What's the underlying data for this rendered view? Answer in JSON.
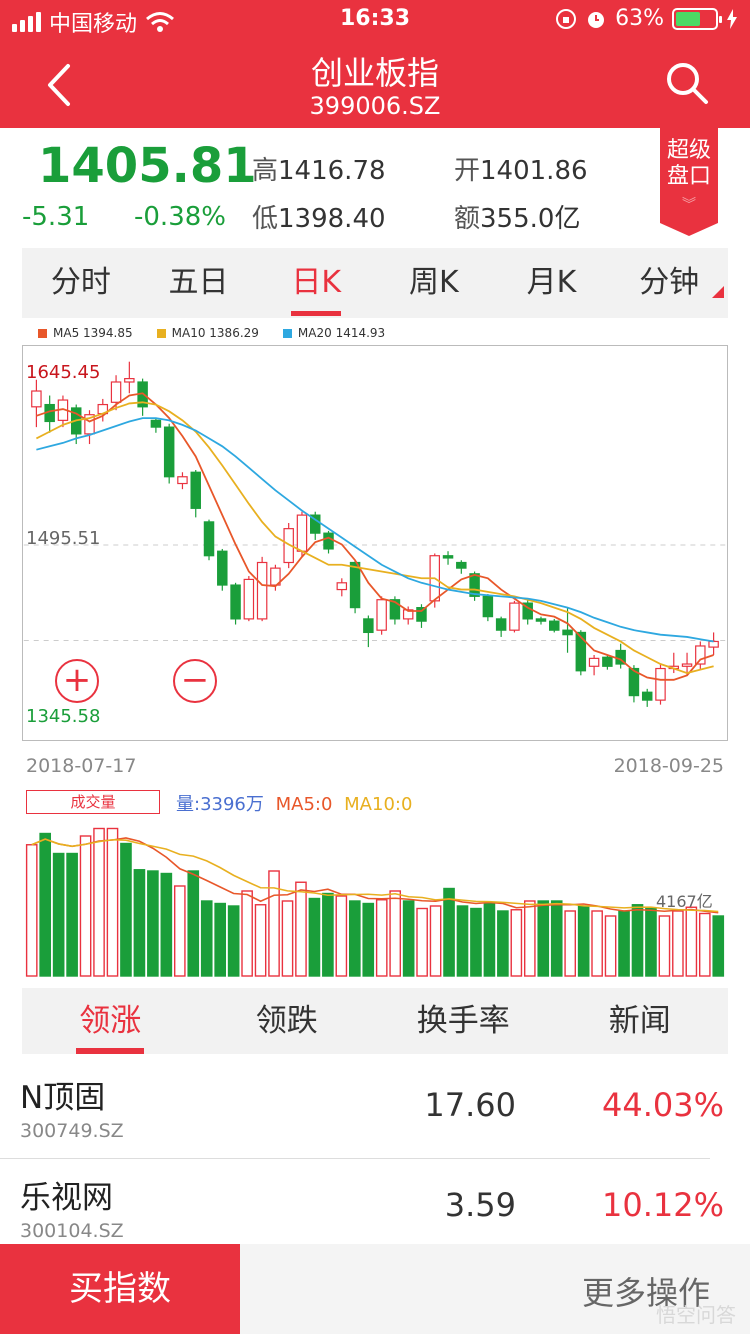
{
  "status": {
    "carrier": "中国移动",
    "time": "16:33",
    "battery": "63%",
    "battery_level": 0.63
  },
  "nav": {
    "title": "创业板指",
    "code": "399006.SZ"
  },
  "quote": {
    "price": "1405.81",
    "change": "-5.31",
    "change_pct": "-0.38%",
    "high_label": "高",
    "high": "1416.78",
    "open_label": "开",
    "open": "1401.86",
    "low_label": "低",
    "low": "1398.40",
    "amount_label": "额",
    "amount": "355.0亿"
  },
  "super_badge": {
    "line1": "超级",
    "line2": "盘口"
  },
  "tabs": [
    "分时",
    "五日",
    "日K",
    "周K",
    "月K",
    "分钟"
  ],
  "active_tab": 2,
  "chart_data": {
    "type": "candlestick",
    "legend": [
      "MA5 1394.85",
      "MA10 1386.29",
      "MA20 1414.93"
    ],
    "ma_colors": [
      "#e8572a",
      "#e8b020",
      "#2ea8e0"
    ],
    "y_labels": [
      "1645.45",
      "1495.51",
      "1345.58"
    ],
    "ylim": [
      1345.58,
      1645.45
    ],
    "start_date": "2018-07-17",
    "end_date": "2018-09-25",
    "candles": [
      [
        1618,
        1632,
        1600,
        1642
      ],
      [
        1620,
        1605,
        1595,
        1628
      ],
      [
        1606,
        1624,
        1600,
        1628
      ],
      [
        1617,
        1594,
        1585,
        1620
      ],
      [
        1594,
        1611,
        1585,
        1615
      ],
      [
        1612,
        1620,
        1605,
        1625
      ],
      [
        1622,
        1640,
        1615,
        1646
      ],
      [
        1640,
        1643,
        1630,
        1658
      ],
      [
        1640,
        1618,
        1610,
        1643
      ],
      [
        1606,
        1600,
        1595,
        1608
      ],
      [
        1600,
        1556,
        1550,
        1603
      ],
      [
        1550,
        1556,
        1545,
        1560
      ],
      [
        1560,
        1528,
        1520,
        1562
      ],
      [
        1516,
        1486,
        1482,
        1518
      ],
      [
        1490,
        1460,
        1455,
        1492
      ],
      [
        1460,
        1430,
        1425,
        1462
      ],
      [
        1430,
        1465,
        1428,
        1468
      ],
      [
        1430,
        1480,
        1428,
        1485
      ],
      [
        1460,
        1475,
        1455,
        1478
      ],
      [
        1480,
        1510,
        1475,
        1515
      ],
      [
        1490,
        1522,
        1485,
        1525
      ],
      [
        1522,
        1506,
        1500,
        1525
      ],
      [
        1506,
        1492,
        1488,
        1508
      ],
      [
        1456,
        1462,
        1450,
        1466
      ],
      [
        1480,
        1440,
        1435,
        1482
      ],
      [
        1430,
        1418,
        1405,
        1433
      ],
      [
        1420,
        1447,
        1416,
        1450
      ],
      [
        1447,
        1430,
        1425,
        1450
      ],
      [
        1430,
        1438,
        1425,
        1441
      ],
      [
        1440,
        1428,
        1422,
        1443
      ],
      [
        1446,
        1486,
        1440,
        1488
      ],
      [
        1486,
        1484,
        1478,
        1490
      ],
      [
        1480,
        1475,
        1470,
        1482
      ],
      [
        1470,
        1450,
        1446,
        1472
      ],
      [
        1450,
        1432,
        1428,
        1452
      ],
      [
        1430,
        1420,
        1414,
        1432
      ],
      [
        1420,
        1444,
        1418,
        1446
      ],
      [
        1444,
        1430,
        1425,
        1448
      ],
      [
        1430,
        1428,
        1425,
        1432
      ],
      [
        1428,
        1420,
        1418,
        1430
      ],
      [
        1420,
        1416,
        1400,
        1440
      ],
      [
        1418,
        1384,
        1380,
        1420
      ],
      [
        1388,
        1395,
        1380,
        1398
      ],
      [
        1396,
        1388,
        1385,
        1398
      ],
      [
        1402,
        1390,
        1386,
        1408
      ],
      [
        1386,
        1362,
        1356,
        1389
      ],
      [
        1365,
        1358,
        1352,
        1368
      ],
      [
        1358,
        1386,
        1354,
        1390
      ],
      [
        1386,
        1388,
        1382,
        1400
      ],
      [
        1388,
        1390,
        1380,
        1400
      ],
      [
        1390,
        1406,
        1385,
        1410
      ],
      [
        1405,
        1410,
        1398,
        1418
      ]
    ],
    "ma5": [
      1610,
      1614,
      1616,
      1612,
      1605,
      1610,
      1620,
      1628,
      1630,
      1620,
      1608,
      1592,
      1574,
      1548,
      1522,
      1496,
      1472,
      1460,
      1459,
      1470,
      1485,
      1498,
      1502,
      1496,
      1482,
      1462,
      1448,
      1445,
      1437,
      1437,
      1447,
      1456,
      1465,
      1469,
      1466,
      1456,
      1448,
      1440,
      1434,
      1432,
      1426,
      1414,
      1402,
      1398,
      1394,
      1384,
      1378,
      1376,
      1376,
      1380,
      1394,
      1398
    ],
    "ma10": [
      1590,
      1596,
      1602,
      1606,
      1608,
      1612,
      1617,
      1621,
      1622,
      1620,
      1614,
      1606,
      1596,
      1582,
      1566,
      1549,
      1532,
      1516,
      1503,
      1496,
      1490,
      1484,
      1478,
      1478,
      1476,
      1474,
      1472,
      1470,
      1468,
      1466,
      1466,
      1458,
      1456,
      1456,
      1454,
      1452,
      1450,
      1447,
      1444,
      1440,
      1436,
      1430,
      1422,
      1416,
      1410,
      1402,
      1396,
      1390,
      1386,
      1382,
      1385,
      1388
    ],
    "ma20": [
      1580,
      1583,
      1586,
      1590,
      1593,
      1597,
      1601,
      1605,
      1608,
      1608,
      1606,
      1602,
      1597,
      1590,
      1583,
      1574,
      1564,
      1554,
      1544,
      1535,
      1526,
      1518,
      1510,
      1502,
      1494,
      1486,
      1478,
      1472,
      1466,
      1462,
      1459,
      1456,
      1454,
      1452,
      1451,
      1450,
      1449,
      1448,
      1446,
      1443,
      1440,
      1436,
      1431,
      1427,
      1423,
      1420,
      1418,
      1416,
      1415,
      1414,
      1412,
      1410
    ]
  },
  "volume": {
    "label": "成交量",
    "vol_text": "量:3396万",
    "ma5_text": "MA5:0",
    "ma10_text": "MA10:0",
    "scale_label": "4167亿",
    "bars": [
      105,
      114,
      98,
      98,
      112,
      118,
      118,
      106,
      85,
      84,
      82,
      72,
      84,
      60,
      58,
      56,
      68,
      57,
      84,
      60,
      75,
      62,
      66,
      64,
      60,
      58,
      61,
      68,
      60,
      54,
      56,
      70,
      56,
      54,
      58,
      52,
      53,
      60,
      60,
      60,
      52,
      56,
      52,
      48,
      52,
      57,
      54,
      48,
      52,
      55,
      50,
      48
    ],
    "bar_up": [
      1,
      0,
      0,
      0,
      1,
      1,
      1,
      0,
      0,
      0,
      0,
      1,
      0,
      0,
      0,
      0,
      1,
      1,
      1,
      1,
      1,
      0,
      0,
      1,
      0,
      0,
      1,
      1,
      0,
      1,
      1,
      0,
      0,
      0,
      0,
      0,
      1,
      1,
      0,
      0,
      1,
      0,
      1,
      1,
      0,
      0,
      0,
      1,
      1,
      1,
      1,
      0
    ]
  },
  "bottom_tabs": [
    "领涨",
    "领跌",
    "换手率",
    "新闻"
  ],
  "bottom_active": 0,
  "rows": [
    {
      "name": "N顶固",
      "code": "300749.SZ",
      "price": "17.60",
      "pct": "44.03%"
    },
    {
      "name": "乐视网",
      "code": "300104.SZ",
      "price": "3.59",
      "pct": "10.12%"
    }
  ],
  "footer": {
    "buy": "买指数",
    "more": "更多操作",
    "watermark": "悟空问答"
  }
}
